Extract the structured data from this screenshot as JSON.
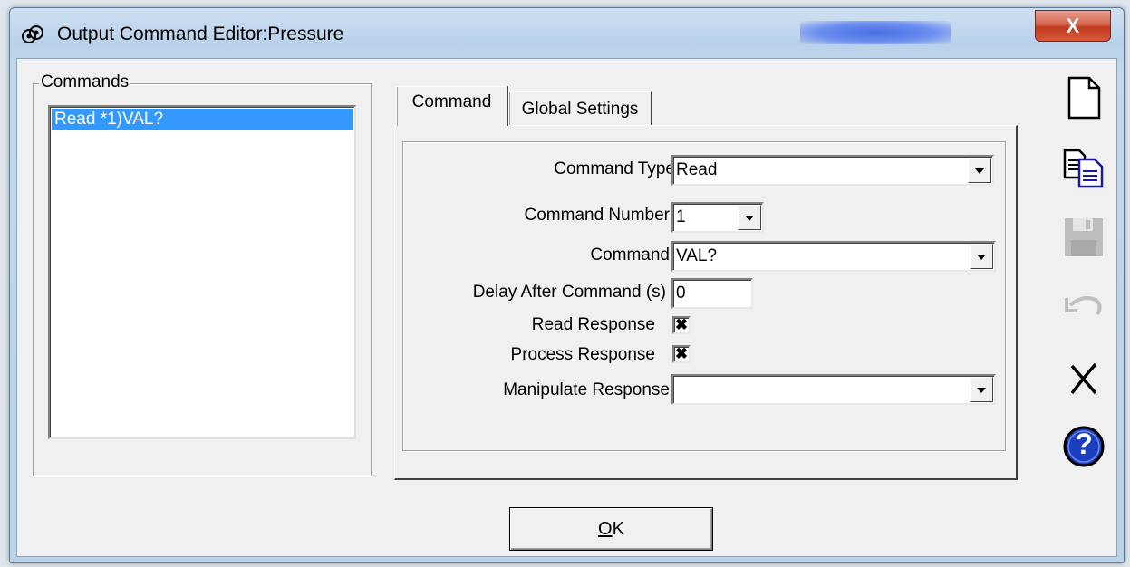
{
  "window": {
    "title": "Output Command Editor:Pressure",
    "close_glyph": "X"
  },
  "commands_group": {
    "legend": "Commands",
    "items": [
      "Read *1)VAL?"
    ],
    "selected_index": 0
  },
  "tabs": [
    {
      "label": "Command",
      "active": true
    },
    {
      "label": "Global Settings",
      "active": false
    }
  ],
  "form": {
    "command_type": {
      "label": "Command Type",
      "value": "Read"
    },
    "command_number": {
      "label": "Command Number",
      "value": "1"
    },
    "command": {
      "label": "Command",
      "value": "VAL?"
    },
    "delay": {
      "label": "Delay After Command (s)",
      "value": "0"
    },
    "read_response": {
      "label": "Read Response",
      "checked": true,
      "mark": "✖"
    },
    "process_response": {
      "label": "Process Response",
      "checked": true,
      "mark": "✖"
    },
    "manipulate_response": {
      "label": "Manipulate Response",
      "value": ""
    }
  },
  "ok_button": {
    "label_underlined": "O",
    "label_rest": "K"
  },
  "toolbar": {
    "icons": [
      "new-document-icon",
      "copy-icon",
      "save-icon",
      "undo-icon",
      "delete-icon",
      "help-icon"
    ],
    "disabled": [
      "save-icon",
      "undo-icon"
    ],
    "help_glyph": "?"
  },
  "colors": {
    "selection": "#3399ff",
    "help_blue": "#1c3fbf",
    "close_red": "#c33b1f",
    "disabled_gray": "#c0c0c0"
  }
}
